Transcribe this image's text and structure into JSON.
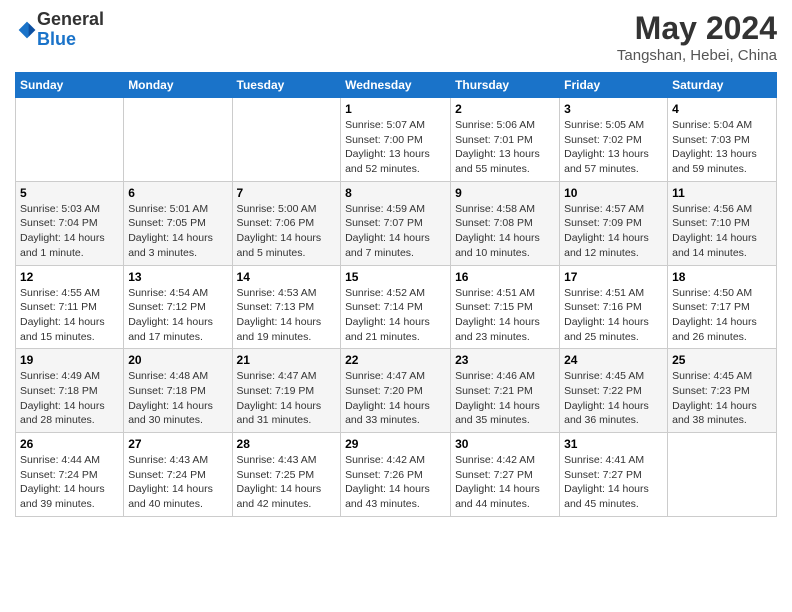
{
  "logo": {
    "general": "General",
    "blue": "Blue"
  },
  "header": {
    "title": "May 2024",
    "subtitle": "Tangshan, Hebei, China"
  },
  "weekdays": [
    "Sunday",
    "Monday",
    "Tuesday",
    "Wednesday",
    "Thursday",
    "Friday",
    "Saturday"
  ],
  "weeks": [
    [
      {
        "day": "",
        "info": ""
      },
      {
        "day": "",
        "info": ""
      },
      {
        "day": "",
        "info": ""
      },
      {
        "day": "1",
        "info": "Sunrise: 5:07 AM\nSunset: 7:00 PM\nDaylight: 13 hours and 52 minutes."
      },
      {
        "day": "2",
        "info": "Sunrise: 5:06 AM\nSunset: 7:01 PM\nDaylight: 13 hours and 55 minutes."
      },
      {
        "day": "3",
        "info": "Sunrise: 5:05 AM\nSunset: 7:02 PM\nDaylight: 13 hours and 57 minutes."
      },
      {
        "day": "4",
        "info": "Sunrise: 5:04 AM\nSunset: 7:03 PM\nDaylight: 13 hours and 59 minutes."
      }
    ],
    [
      {
        "day": "5",
        "info": "Sunrise: 5:03 AM\nSunset: 7:04 PM\nDaylight: 14 hours and 1 minute."
      },
      {
        "day": "6",
        "info": "Sunrise: 5:01 AM\nSunset: 7:05 PM\nDaylight: 14 hours and 3 minutes."
      },
      {
        "day": "7",
        "info": "Sunrise: 5:00 AM\nSunset: 7:06 PM\nDaylight: 14 hours and 5 minutes."
      },
      {
        "day": "8",
        "info": "Sunrise: 4:59 AM\nSunset: 7:07 PM\nDaylight: 14 hours and 7 minutes."
      },
      {
        "day": "9",
        "info": "Sunrise: 4:58 AM\nSunset: 7:08 PM\nDaylight: 14 hours and 10 minutes."
      },
      {
        "day": "10",
        "info": "Sunrise: 4:57 AM\nSunset: 7:09 PM\nDaylight: 14 hours and 12 minutes."
      },
      {
        "day": "11",
        "info": "Sunrise: 4:56 AM\nSunset: 7:10 PM\nDaylight: 14 hours and 14 minutes."
      }
    ],
    [
      {
        "day": "12",
        "info": "Sunrise: 4:55 AM\nSunset: 7:11 PM\nDaylight: 14 hours and 15 minutes."
      },
      {
        "day": "13",
        "info": "Sunrise: 4:54 AM\nSunset: 7:12 PM\nDaylight: 14 hours and 17 minutes."
      },
      {
        "day": "14",
        "info": "Sunrise: 4:53 AM\nSunset: 7:13 PM\nDaylight: 14 hours and 19 minutes."
      },
      {
        "day": "15",
        "info": "Sunrise: 4:52 AM\nSunset: 7:14 PM\nDaylight: 14 hours and 21 minutes."
      },
      {
        "day": "16",
        "info": "Sunrise: 4:51 AM\nSunset: 7:15 PM\nDaylight: 14 hours and 23 minutes."
      },
      {
        "day": "17",
        "info": "Sunrise: 4:51 AM\nSunset: 7:16 PM\nDaylight: 14 hours and 25 minutes."
      },
      {
        "day": "18",
        "info": "Sunrise: 4:50 AM\nSunset: 7:17 PM\nDaylight: 14 hours and 26 minutes."
      }
    ],
    [
      {
        "day": "19",
        "info": "Sunrise: 4:49 AM\nSunset: 7:18 PM\nDaylight: 14 hours and 28 minutes."
      },
      {
        "day": "20",
        "info": "Sunrise: 4:48 AM\nSunset: 7:18 PM\nDaylight: 14 hours and 30 minutes."
      },
      {
        "day": "21",
        "info": "Sunrise: 4:47 AM\nSunset: 7:19 PM\nDaylight: 14 hours and 31 minutes."
      },
      {
        "day": "22",
        "info": "Sunrise: 4:47 AM\nSunset: 7:20 PM\nDaylight: 14 hours and 33 minutes."
      },
      {
        "day": "23",
        "info": "Sunrise: 4:46 AM\nSunset: 7:21 PM\nDaylight: 14 hours and 35 minutes."
      },
      {
        "day": "24",
        "info": "Sunrise: 4:45 AM\nSunset: 7:22 PM\nDaylight: 14 hours and 36 minutes."
      },
      {
        "day": "25",
        "info": "Sunrise: 4:45 AM\nSunset: 7:23 PM\nDaylight: 14 hours and 38 minutes."
      }
    ],
    [
      {
        "day": "26",
        "info": "Sunrise: 4:44 AM\nSunset: 7:24 PM\nDaylight: 14 hours and 39 minutes."
      },
      {
        "day": "27",
        "info": "Sunrise: 4:43 AM\nSunset: 7:24 PM\nDaylight: 14 hours and 40 minutes."
      },
      {
        "day": "28",
        "info": "Sunrise: 4:43 AM\nSunset: 7:25 PM\nDaylight: 14 hours and 42 minutes."
      },
      {
        "day": "29",
        "info": "Sunrise: 4:42 AM\nSunset: 7:26 PM\nDaylight: 14 hours and 43 minutes."
      },
      {
        "day": "30",
        "info": "Sunrise: 4:42 AM\nSunset: 7:27 PM\nDaylight: 14 hours and 44 minutes."
      },
      {
        "day": "31",
        "info": "Sunrise: 4:41 AM\nSunset: 7:27 PM\nDaylight: 14 hours and 45 minutes."
      },
      {
        "day": "",
        "info": ""
      }
    ]
  ]
}
